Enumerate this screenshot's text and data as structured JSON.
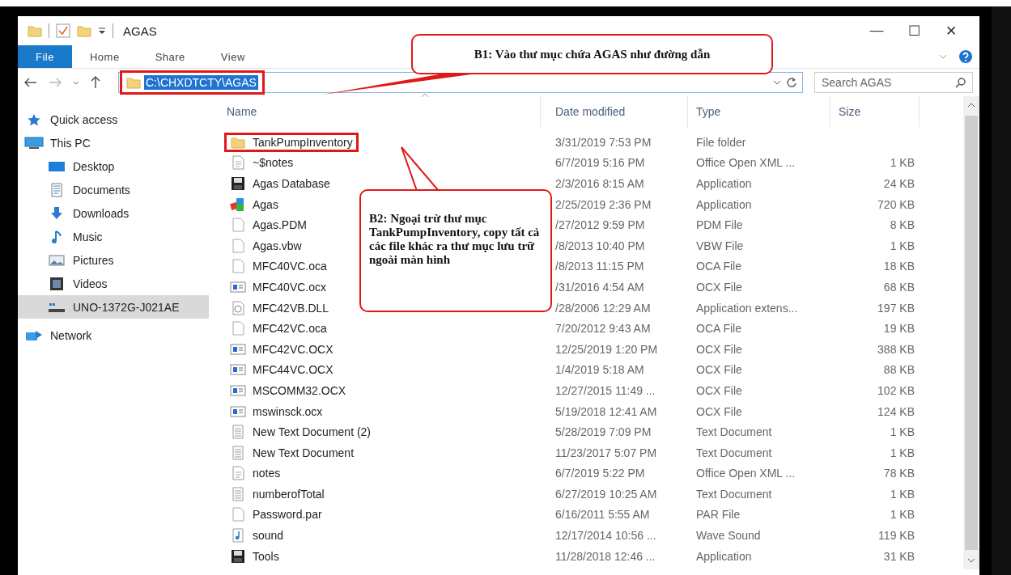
{
  "window": {
    "title": "AGAS",
    "controls": [
      "—",
      "☐",
      "✕"
    ]
  },
  "ribbon": {
    "tabs": [
      {
        "label": "File",
        "selected": true
      },
      {
        "label": "Home",
        "selected": false
      },
      {
        "label": "Share",
        "selected": false
      },
      {
        "label": "View",
        "selected": false
      }
    ]
  },
  "address_bar": {
    "path": "C:\\CHXDTCTY\\AGAS",
    "selected": true,
    "annotated": true,
    "search_placeholder": "Search AGAS"
  },
  "sidebar": {
    "items": [
      {
        "label": "Quick access",
        "selected": false
      },
      {
        "label": "This PC",
        "selected": false,
        "children": [
          {
            "label": "Desktop",
            "selected": false
          },
          {
            "label": "Documents",
            "selected": false
          },
          {
            "label": "Downloads",
            "selected": false
          },
          {
            "label": "Music",
            "selected": false
          },
          {
            "label": "Pictures",
            "selected": false
          },
          {
            "label": "Videos",
            "selected": false
          },
          {
            "label": "UNO-1372G-J021AE",
            "selected": true
          }
        ]
      },
      {
        "label": "Network",
        "selected": false
      }
    ]
  },
  "file_list": {
    "columns": [
      "Name",
      "Date modified",
      "Type",
      "Size"
    ],
    "rows": [
      {
        "name": "TankPumpInventory",
        "date": "3/31/2019 7:53 PM",
        "type": "File folder",
        "kind": "folder",
        "annotated": true
      },
      {
        "name": "~$notes",
        "date": "6/7/2019 5:16 PM",
        "type": "Office Open XML ...",
        "size": "1 KB",
        "kind": "doc",
        "annotated": false
      },
      {
        "name": "Agas Database",
        "date": "2/3/2016 8:15 AM",
        "type": "Application",
        "size": "24 KB",
        "kind": "floppy",
        "annotated": false
      },
      {
        "name": "Agas",
        "date": "2/25/2019 2:36 PM",
        "type": "Application",
        "size": "720 KB",
        "kind": "app",
        "annotated": false
      },
      {
        "name": "Agas.PDM",
        "date": "/27/2012 9:59 PM",
        "type": "PDM File",
        "size": "8 KB",
        "kind": "blank",
        "annotated": false
      },
      {
        "name": "Agas.vbw",
        "date": "/8/2013 10:40 PM",
        "type": "VBW File",
        "size": "1 KB",
        "kind": "blank",
        "annotated": false
      },
      {
        "name": "MFC40VC.oca",
        "date": "/8/2013 11:15 PM",
        "type": "OCA File",
        "size": "18 KB",
        "kind": "blank",
        "annotated": false
      },
      {
        "name": "MFC40VC.ocx",
        "date": "/31/2016 4:54 AM",
        "type": "OCX File",
        "size": "68 KB",
        "kind": "ocx",
        "annotated": false
      },
      {
        "name": "MFC42VB.DLL",
        "date": "/28/2006 12:29 AM",
        "type": "Application extens...",
        "size": "197 KB",
        "kind": "dll",
        "annotated": false
      },
      {
        "name": "MFC42VC.oca",
        "date": "7/20/2012 9:43 AM",
        "type": "OCA File",
        "size": "19 KB",
        "kind": "blank",
        "annotated": false
      },
      {
        "name": "MFC42VC.OCX",
        "date": "12/25/2019 1:20 PM",
        "type": "OCX File",
        "size": "388 KB",
        "kind": "ocx",
        "annotated": false
      },
      {
        "name": "MFC44VC.OCX",
        "date": "1/4/2019 5:18 AM",
        "type": "OCX File",
        "size": "88 KB",
        "kind": "ocx",
        "annotated": false
      },
      {
        "name": "MSCOMM32.OCX",
        "date": "12/27/2015 11:49 ...",
        "type": "OCX File",
        "size": "102 KB",
        "kind": "ocx",
        "annotated": false
      },
      {
        "name": "mswinsck.ocx",
        "date": "5/19/2018 12:41 AM",
        "type": "OCX File",
        "size": "124 KB",
        "kind": "ocx",
        "annotated": false
      },
      {
        "name": "New Text Document (2)",
        "date": "5/28/2019 7:09 PM",
        "type": "Text Document",
        "size": "1 KB",
        "kind": "text",
        "annotated": false
      },
      {
        "name": "New Text Document",
        "date": "11/23/2017 5:07 PM",
        "type": "Text Document",
        "size": "1 KB",
        "kind": "text",
        "annotated": false
      },
      {
        "name": "notes",
        "date": "6/7/2019 5:22 PM",
        "type": "Office Open XML ...",
        "size": "78 KB",
        "kind": "doc",
        "annotated": false
      },
      {
        "name": "numberofTotal",
        "date": "6/27/2019 10:25 AM",
        "type": "Text Document",
        "size": "1 KB",
        "kind": "text",
        "annotated": false
      },
      {
        "name": "Password.par",
        "date": "6/16/2011 5:55 AM",
        "type": "PAR File",
        "size": "1 KB",
        "kind": "blank",
        "annotated": false
      },
      {
        "name": "sound",
        "date": "12/17/2014 10:56 ...",
        "type": "Wave Sound",
        "size": "119 KB",
        "kind": "sound",
        "annotated": false
      },
      {
        "name": "Tools",
        "date": "11/28/2018 12:46 ...",
        "type": "Application",
        "size": "31 KB",
        "kind": "floppy",
        "annotated": false
      }
    ]
  },
  "callouts": [
    {
      "kind": "top",
      "text": "B1: Vào thư mục chứa AGAS như đường dẫn"
    },
    {
      "kind": "side",
      "text": "B2: Ngoại trừ thư mục TankPumpInventory, copy tất cả các file khác ra thư mục lưu trữ ngoài màn hình"
    }
  ]
}
